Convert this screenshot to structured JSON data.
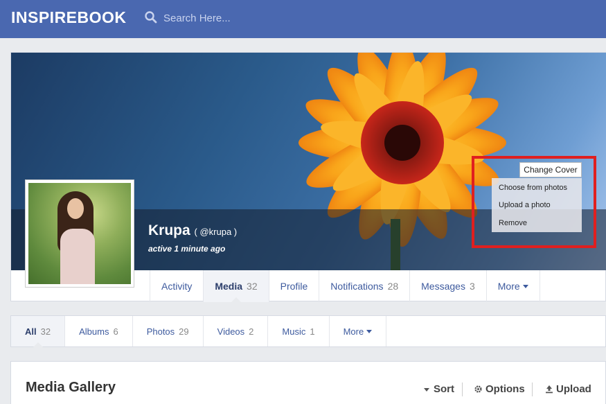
{
  "header": {
    "logo": "INSPIREBOOK",
    "search_placeholder": "Search Here..."
  },
  "profile": {
    "name": "Krupa",
    "handle": "( @krupa )",
    "status": "active 1 minute ago"
  },
  "cover_menu": {
    "button_label": "Change Cover",
    "items": [
      "Choose from photos",
      "Upload a photo",
      "Remove"
    ],
    "highlight_color": "#e01f1f"
  },
  "profile_tabs": [
    {
      "label": "Activity",
      "count": ""
    },
    {
      "label": "Media",
      "count": "32",
      "active": true
    },
    {
      "label": "Profile",
      "count": ""
    },
    {
      "label": "Notifications",
      "count": "28"
    },
    {
      "label": "Messages",
      "count": "3"
    },
    {
      "label": "More",
      "count": ""
    }
  ],
  "media_tabs": [
    {
      "label": "All",
      "count": "32",
      "active": true
    },
    {
      "label": "Albums",
      "count": "6"
    },
    {
      "label": "Photos",
      "count": "29"
    },
    {
      "label": "Videos",
      "count": "2"
    },
    {
      "label": "Music",
      "count": "1"
    },
    {
      "label": "More",
      "count": ""
    }
  ],
  "gallery": {
    "title": "Media Gallery",
    "sort_label": "Sort",
    "options_label": "Options",
    "upload_label": "Upload"
  },
  "colors": {
    "topbar": "#4a68b0",
    "link": "#3d5a9e"
  }
}
